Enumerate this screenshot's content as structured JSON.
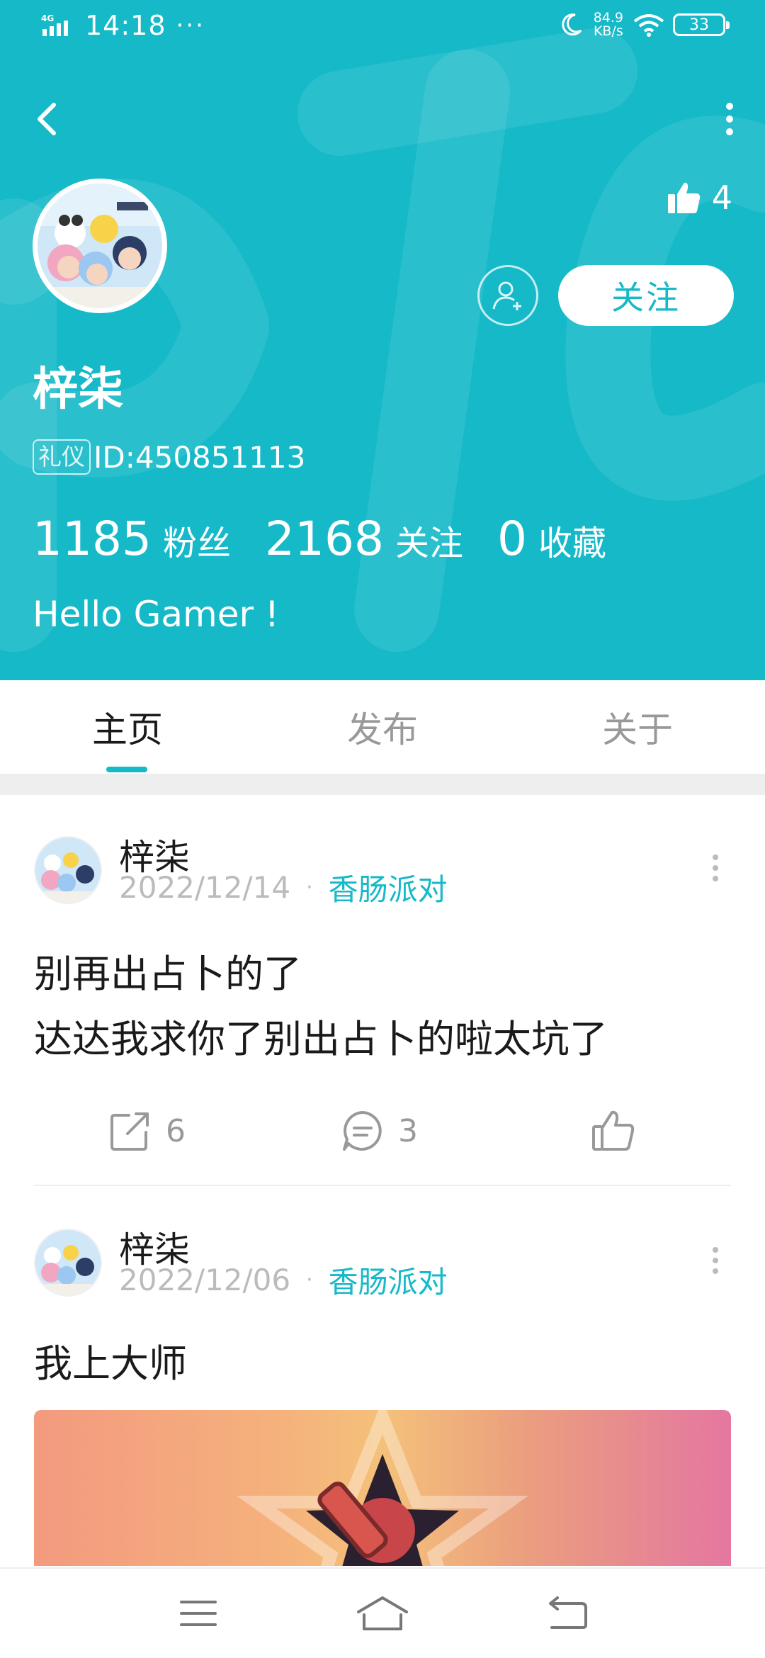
{
  "status_bar": {
    "network": "4G",
    "time": "14:18",
    "more": "···",
    "speed_value": "84.9",
    "speed_unit": "KB/s",
    "battery": "33"
  },
  "profile": {
    "like_count": "4",
    "follow_label": "关注",
    "username": "梓柒",
    "badge": "礼仪",
    "id_text": "ID:450851113",
    "stats": [
      {
        "num": "1185",
        "label": "粉丝"
      },
      {
        "num": "2168",
        "label": "关注"
      },
      {
        "num": "0",
        "label": "收藏"
      }
    ],
    "bio": "Hello Gamer !"
  },
  "tabs": [
    {
      "label": "主页",
      "active": true
    },
    {
      "label": "发布",
      "active": false
    },
    {
      "label": "关于",
      "active": false
    }
  ],
  "posts": [
    {
      "author": "梓柒",
      "date": "2022/12/14",
      "circle": "香肠派对",
      "title": "别再出占卜的了",
      "body": "达达我求你了别出占卜的啦太坑了",
      "shares": "6",
      "comments": "3"
    },
    {
      "author": "梓柒",
      "date": "2022/12/06",
      "circle": "香肠派对",
      "title": "我上大师"
    }
  ],
  "colors": {
    "accent": "#15b9c8",
    "muted": "#999999"
  },
  "icons": {
    "back": "chevron-left-icon",
    "more": "more-vertical-icon",
    "like": "thumbs-up-icon",
    "add_friend": "user-plus-icon",
    "share": "share-icon",
    "comment": "comment-icon",
    "nav_menu": "menu-icon",
    "nav_home": "home-icon",
    "nav_back": "back-icon"
  }
}
